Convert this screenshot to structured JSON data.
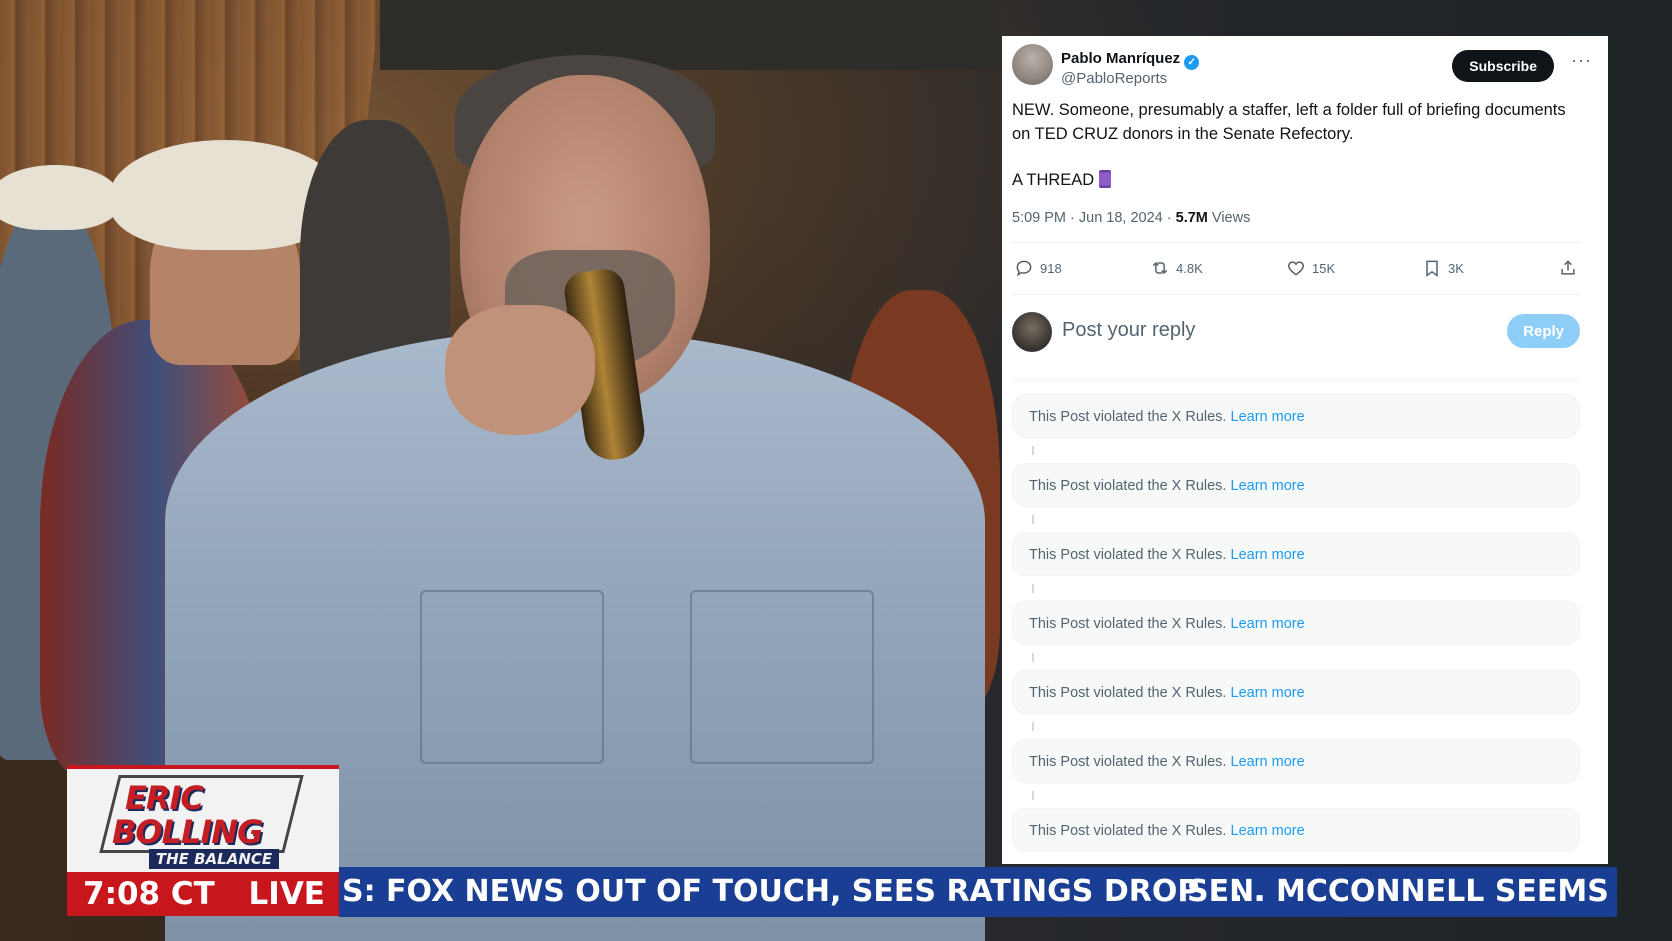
{
  "tweet": {
    "author_name": "Pablo Manríquez",
    "author_handle": "@PabloReports",
    "subscribe_label": "Subscribe",
    "more_label": "···",
    "text": "NEW. Someone, presumably a staffer, left a folder full of briefing documents on TED CRUZ donors in the Senate Refectory.",
    "thread_label": "A THREAD",
    "timestamp": "5:09 PM · Jun 18, 2024 · ",
    "views_count": "5.7M",
    "views_label": " Views",
    "replies": "918",
    "reposts": "4.8K",
    "likes": "15K",
    "bookmarks": "3K",
    "reply_placeholder": "Post your reply",
    "reply_button": "Reply",
    "violation_text": "This Post violated the X Rules. ",
    "learn_more": "Learn more",
    "colors": {
      "accent": "#1d9bf0",
      "reply_button": "#8ecdf8",
      "subscribe_bg": "#0f1419"
    }
  },
  "broadcast": {
    "show_name_line1": "ERIC",
    "show_name_line2": "BOLLING",
    "show_subtitle": "THE BALANCE",
    "time": "7:08 CT",
    "live_label": "LIVE",
    "ticker_1": "S: FOX NEWS OUT OF TOUCH, SEES RATINGS DROP . . .",
    "ticker_2": "SEN. MCCONNELL SEEMS TO",
    "colors": {
      "time_bar": "#c8161d",
      "ticker": "#1a3e93"
    }
  }
}
